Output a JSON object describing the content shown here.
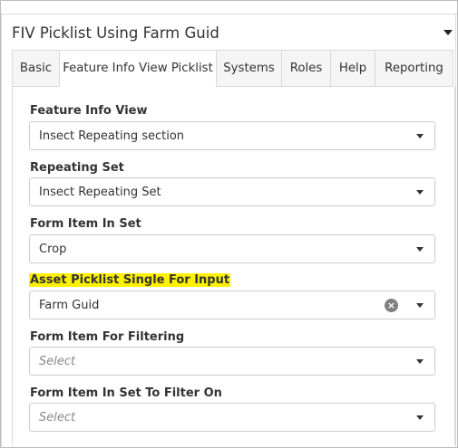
{
  "panel": {
    "title": "FIV Picklist Using Farm Guid"
  },
  "tabs": [
    {
      "label": "Basic"
    },
    {
      "label": "Feature Info View Picklist"
    },
    {
      "label": "Systems"
    },
    {
      "label": "Roles"
    },
    {
      "label": "Help"
    },
    {
      "label": "Reporting"
    }
  ],
  "active_tab": "Feature Info View Picklist",
  "fields": [
    {
      "label": "Feature Info View",
      "value": "Insect Repeating section"
    },
    {
      "label": "Repeating Set",
      "value": "Insect Repeating Set"
    },
    {
      "label": "Form Item In Set",
      "value": "Crop"
    },
    {
      "label": "Asset Picklist Single For Input",
      "value": "Farm Guid",
      "highlighted": true
    },
    {
      "label": "Form Item For Filtering",
      "placeholder": "Select"
    },
    {
      "label": "Form Item In Set To Filter On",
      "placeholder": "Select"
    }
  ],
  "icons": {
    "collapse": "caret-down-icon",
    "dropdown": "chevron-down-icon",
    "clear": "clear-circle-x-icon"
  },
  "colors": {
    "highlight": "#fff200",
    "border": "#cccccc",
    "clear_icon": "#808080"
  }
}
